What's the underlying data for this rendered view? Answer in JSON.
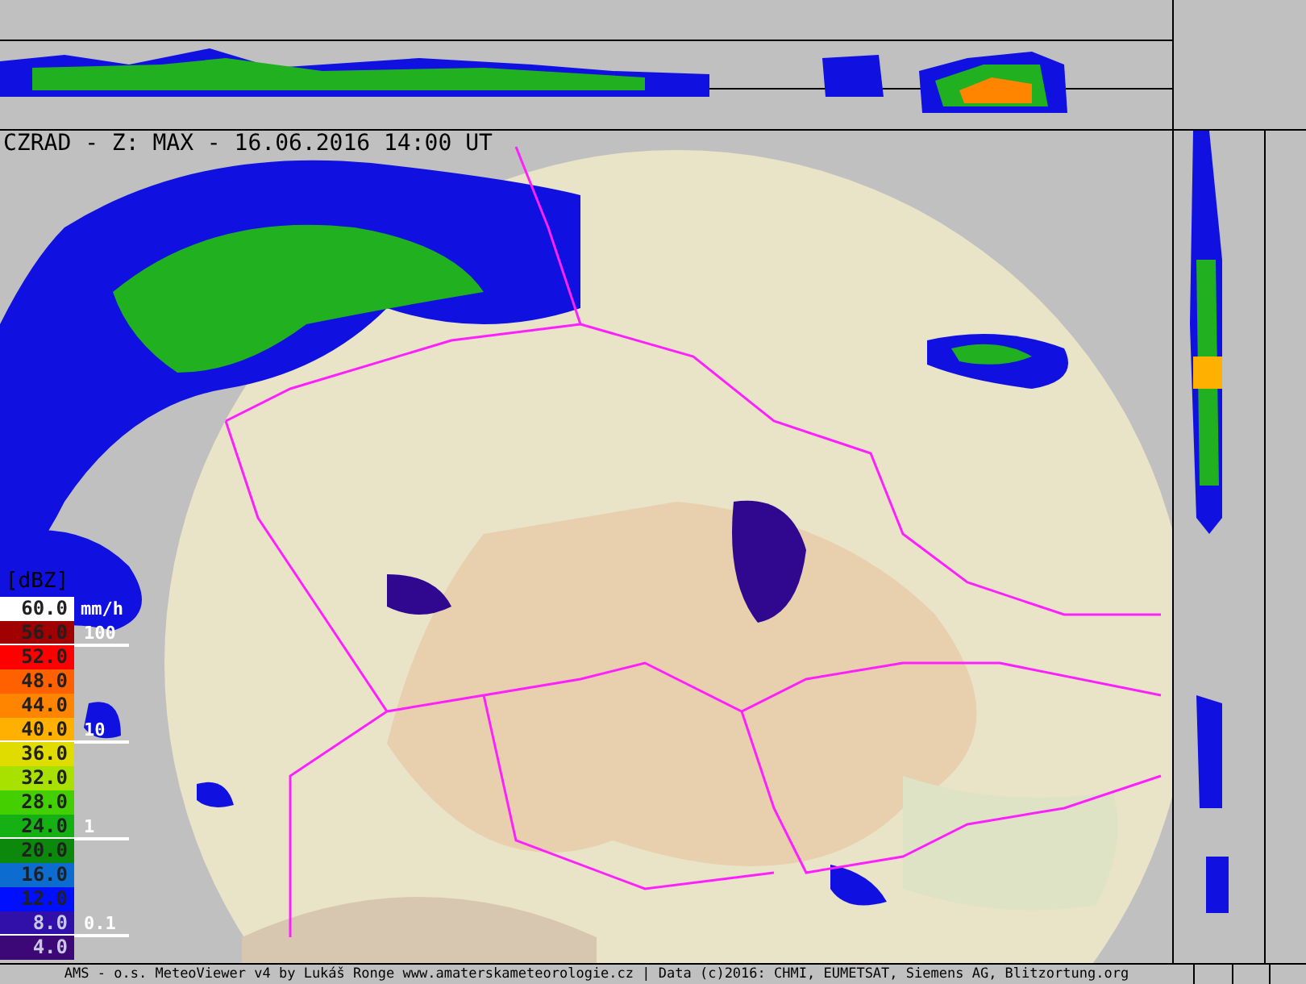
{
  "title": "CZRAD - Z: MAX - 16.06.2016 14:00 UT",
  "legend": {
    "header": "[dBZ]",
    "unit": "mm/h",
    "items": [
      {
        "value": "60.0",
        "color": "#ffffff"
      },
      {
        "value": "56.0",
        "color": "#a00000",
        "rain_rate": "100"
      },
      {
        "value": "52.0",
        "color": "#ff0000"
      },
      {
        "value": "48.0",
        "color": "#ff6000"
      },
      {
        "value": "44.0",
        "color": "#ff8400"
      },
      {
        "value": "40.0",
        "color": "#ffb000",
        "rain_rate": "10"
      },
      {
        "value": "36.0",
        "color": "#e0dc00"
      },
      {
        "value": "32.0",
        "color": "#a8e000"
      },
      {
        "value": "28.0",
        "color": "#44d000"
      },
      {
        "value": "24.0",
        "color": "#14b014",
        "rain_rate": "1"
      },
      {
        "value": "20.0",
        "color": "#0c880c"
      },
      {
        "value": "16.0",
        "color": "#0c6cd0"
      },
      {
        "value": "12.0",
        "color": "#0010ff"
      },
      {
        "value": "8.0",
        "color": "#3010a8",
        "rain_rate": "0.1"
      },
      {
        "value": "4.0",
        "color": "#3c0878"
      }
    ]
  },
  "footer": "AMS - o.s. MeteoViewer v4 by Lukáš Ronge www.amaterskameteorologie.cz | Data (c)2016: CHMI, EUMETSAT, Siemens AG, Blitzortung.org"
}
